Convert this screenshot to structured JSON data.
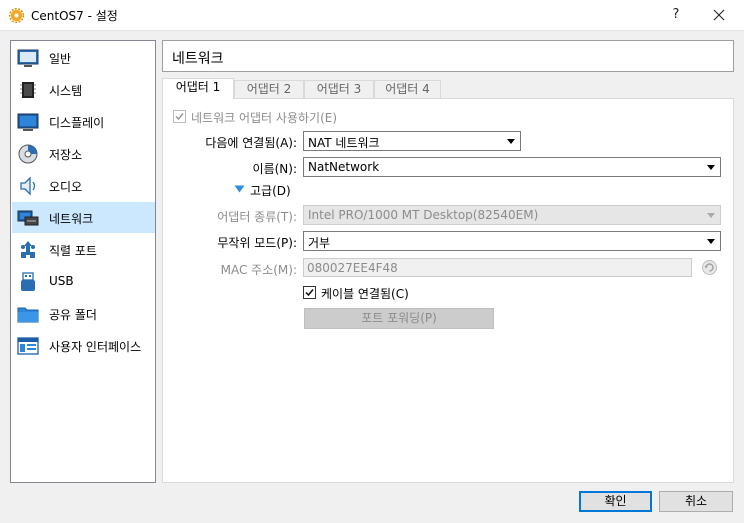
{
  "window": {
    "title": "CentOS7 - 설정",
    "help_label": "?",
    "close_icon": "close-icon"
  },
  "sidebar": {
    "items": [
      {
        "label": "일반",
        "icon": "general-icon"
      },
      {
        "label": "시스템",
        "icon": "system-icon"
      },
      {
        "label": "디스플레이",
        "icon": "display-icon"
      },
      {
        "label": "저장소",
        "icon": "storage-icon"
      },
      {
        "label": "오디오",
        "icon": "audio-icon"
      },
      {
        "label": "네트워크",
        "icon": "network-icon",
        "selected": true
      },
      {
        "label": "직렬 포트",
        "icon": "serial-port-icon"
      },
      {
        "label": "USB",
        "icon": "usb-icon"
      },
      {
        "label": "공유 폴더",
        "icon": "shared-folder-icon"
      },
      {
        "label": "사용자 인터페이스",
        "icon": "user-interface-icon"
      }
    ]
  },
  "page": {
    "title": "네트워크"
  },
  "tabs": [
    {
      "label": "어댑터 1",
      "active": true
    },
    {
      "label": "어댑터 2"
    },
    {
      "label": "어댑터 3"
    },
    {
      "label": "어댑터 4"
    }
  ],
  "adapter": {
    "enable_label": "네트워크 어댑터 사용하기(E)",
    "enable_checked": true,
    "attached_label": "다음에 연결됨(A):",
    "attached_value": "NAT 네트워크",
    "name_label": "이름(N):",
    "name_value": "NatNetwork",
    "advanced_label": "고급(D)",
    "adapter_type_label": "어댑터 종류(T):",
    "adapter_type_value": "Intel PRO/1000 MT Desktop(82540EM)",
    "promisc_label": "무작위 모드(P):",
    "promisc_value": "거부",
    "mac_label": "MAC 주소(M):",
    "mac_value": "080027EE4F48",
    "cable_label": "케이블 연결됨(C)",
    "cable_checked": true,
    "port_forwarding_label": "포트 포워딩(P)"
  },
  "buttons": {
    "ok_label": "확인",
    "cancel_label": "취소"
  },
  "colors": {
    "selection": "#cce8ff",
    "accent": "#0078d7",
    "disabled_text": "#8c8c8c"
  }
}
